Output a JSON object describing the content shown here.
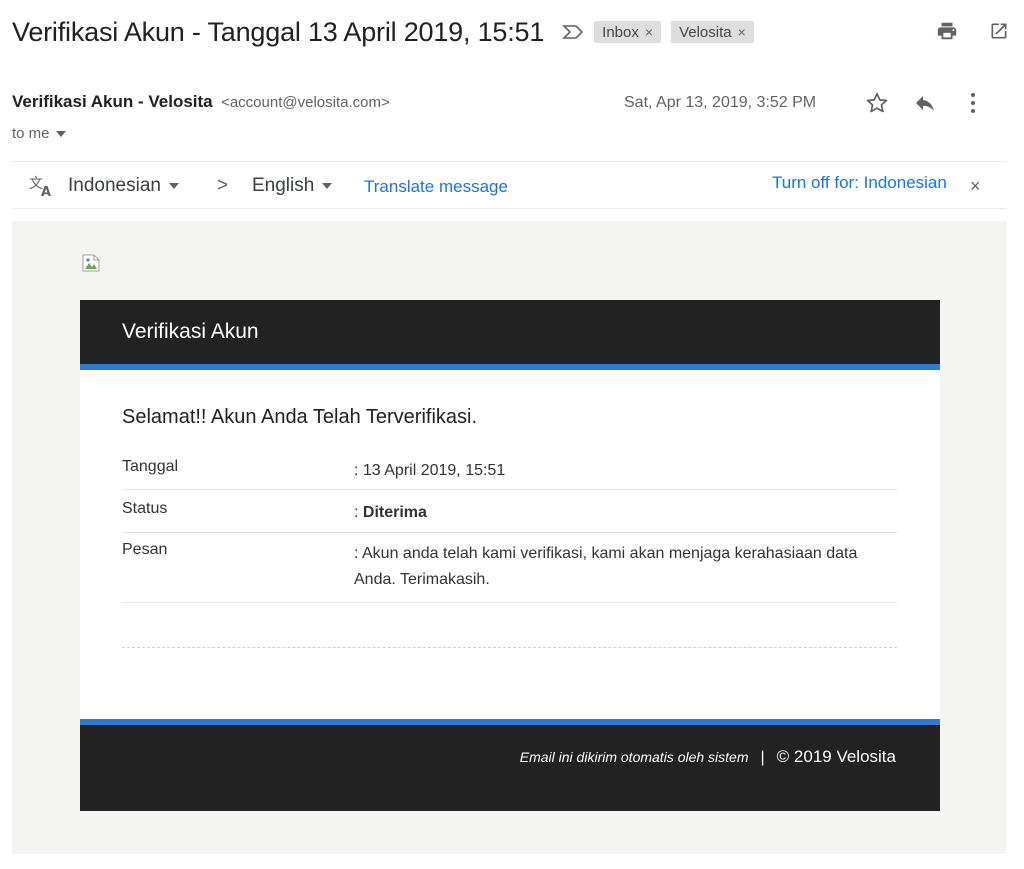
{
  "header": {
    "subject": "Verifikasi Akun - Tanggal 13 April 2019, 15:51",
    "labels": [
      {
        "name": "Inbox",
        "remove": "×"
      },
      {
        "name": "Velosita",
        "remove": "×"
      }
    ],
    "actions": [
      "print-icon",
      "open-in-new-window-icon"
    ]
  },
  "sender": {
    "name": "Verifikasi Akun - Velosita",
    "email": "<account@velosita.com>",
    "recipient": "to me",
    "date": "Sat, Apr 13, 2019, 3:52 PM",
    "actions": [
      "star-icon",
      "reply-icon",
      "more-vert-icon"
    ]
  },
  "translate": {
    "from_language": "Indonesian",
    "arrow": ">",
    "to_language": "English",
    "translate_link": "Translate message",
    "turn_off": "Turn off for: Indonesian",
    "close": "×"
  },
  "email": {
    "card_title": "Verifikasi Akun",
    "headline": "Selamat!! Akun Anda Telah Terverifikasi.",
    "rows": [
      {
        "label": "Tanggal",
        "value": ": 13 April 2019, 15:51"
      },
      {
        "label": "Status",
        "value_prefix": ": ",
        "value_bold": "Diterima"
      },
      {
        "label": "Pesan",
        "value": ": Akun anda telah kami verifikasi, kami akan menjaga kerahasiaan data Anda. Terimakasih."
      }
    ],
    "footer_auto": "Email ini dikirim otomatis oleh sistem",
    "footer_sep": "|",
    "footer_copyright": "© 2019 Velosita"
  },
  "colors": {
    "accent_blue": "#2e7bd1",
    "card_dark": "#222222",
    "link_blue": "#1a73e8",
    "body_bg": "#f4f5f2"
  }
}
